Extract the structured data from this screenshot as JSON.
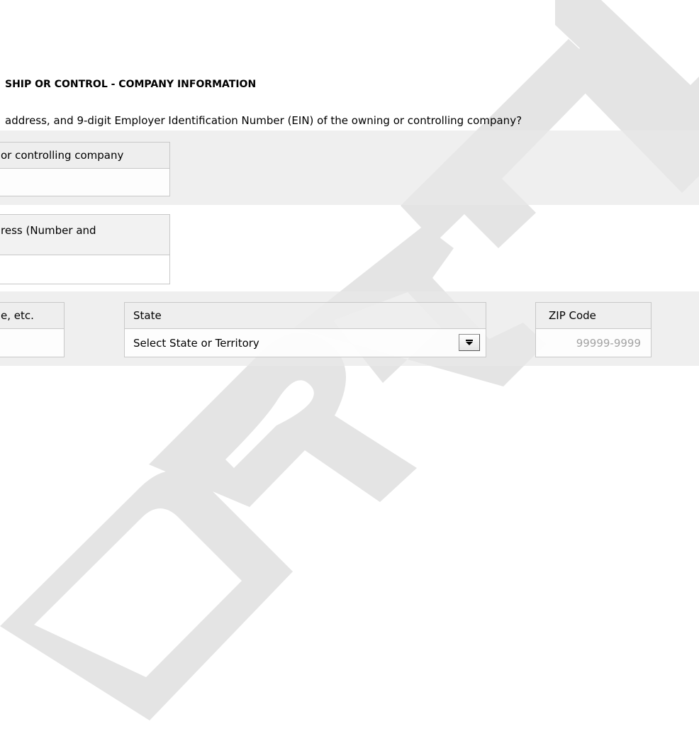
{
  "section": {
    "title": "SHIP OR CONTROL - COMPANY INFORMATION",
    "question": "address, and 9-digit Employer Identification Number (EIN) of the owning or controlling company?"
  },
  "fields": {
    "company_name": {
      "label": "or controlling company",
      "value": ""
    },
    "street_address": {
      "label": "ress (Number and",
      "value": ""
    },
    "city": {
      "label": "e, etc.",
      "value": ""
    },
    "state": {
      "label": "State",
      "selected": "Select State or Territory"
    },
    "zip": {
      "label": "ZIP Code",
      "placeholder": "99999-9999",
      "value": ""
    }
  },
  "watermark": {
    "text": "DRAFT",
    "color": "#e4e4e4"
  },
  "icons": {
    "state_dropdown": "chevron-down-icon"
  }
}
